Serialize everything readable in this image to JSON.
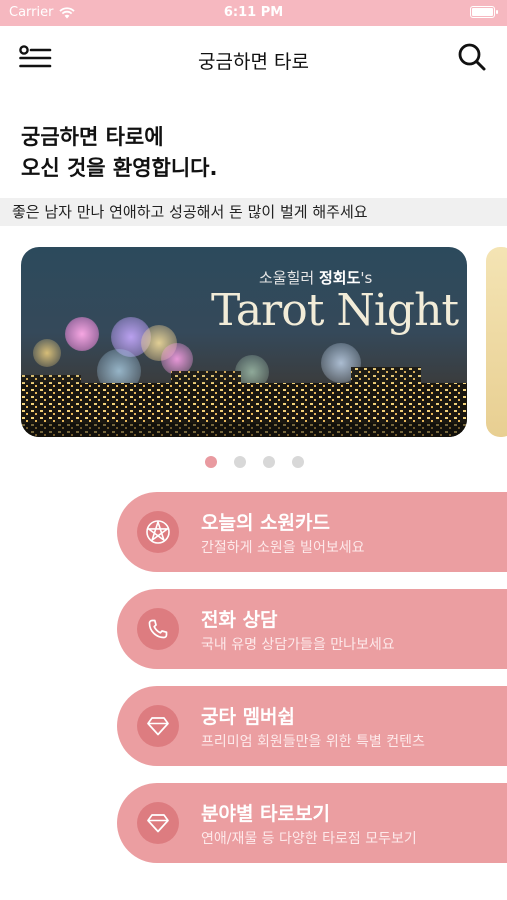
{
  "status_bar": {
    "carrier": "Carrier",
    "time": "6:11 PM"
  },
  "nav": {
    "title": "궁금하면 타로",
    "menu_icon": "menu-icon",
    "search_icon": "search-icon"
  },
  "welcome": {
    "line1": "궁금하면 타로에",
    "line2": "오신 것을 환영합니다."
  },
  "subtitle": "좋은 남자 만나 연애하고 성공해서 돈 많이 벌게 해주세요",
  "banner": {
    "subtitle_prefix": "소울힐러",
    "subtitle_name": "정회도",
    "subtitle_suffix": "'s",
    "title": "Tarot Night"
  },
  "carousel": {
    "page_count": 4,
    "active_index": 0
  },
  "colors": {
    "accent": "#eb9ea1",
    "accent_dark": "#dd7c80",
    "status_bar": "#f6b8c0"
  },
  "menu": [
    {
      "title": "오늘의 소원카드",
      "desc": "간절하게 소원을 빌어보세요",
      "icon": "pentagram-icon"
    },
    {
      "title": "전화 상담",
      "desc": "국내 유명 상담가들을 만나보세요",
      "icon": "phone-icon"
    },
    {
      "title": "궁타 멤버쉽",
      "desc": "프리미엄 회원들만을 위한 특별 컨텐츠",
      "icon": "diamond-icon"
    },
    {
      "title": "분야별 타로보기",
      "desc": "연애/재물 등 다양한 타로점 모두보기",
      "icon": "diamond-icon"
    }
  ]
}
